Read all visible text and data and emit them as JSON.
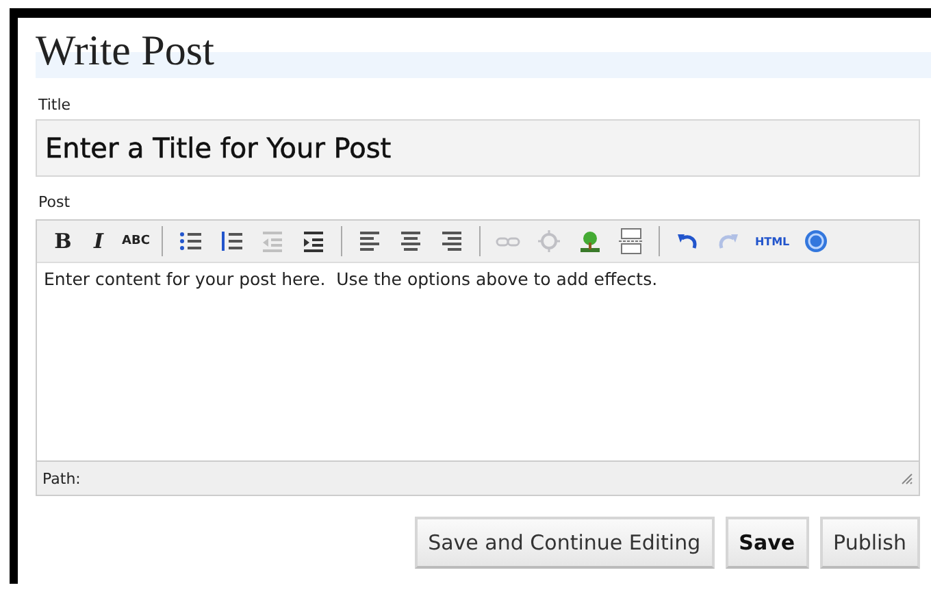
{
  "heading": "Write Post",
  "title_field": {
    "label": "Title",
    "value": "Enter a Title for Your Post"
  },
  "post_editor": {
    "label": "Post",
    "toolbar": [
      {
        "kind": "bold",
        "label": "B",
        "disabled": false
      },
      {
        "kind": "italic",
        "label": "I",
        "disabled": false
      },
      {
        "kind": "strike",
        "label": "ABC",
        "disabled": false
      },
      {
        "kind": "separator"
      },
      {
        "kind": "bullets",
        "disabled": false
      },
      {
        "kind": "numbers",
        "disabled": false
      },
      {
        "kind": "outdent",
        "disabled": true
      },
      {
        "kind": "indent",
        "disabled": false
      },
      {
        "kind": "separator"
      },
      {
        "kind": "align-left",
        "disabled": false
      },
      {
        "kind": "align-center",
        "disabled": false
      },
      {
        "kind": "align-right",
        "disabled": false
      },
      {
        "kind": "separator"
      },
      {
        "kind": "link",
        "disabled": true
      },
      {
        "kind": "unlink",
        "disabled": true
      },
      {
        "kind": "image",
        "disabled": false
      },
      {
        "kind": "pagebreak",
        "disabled": false
      },
      {
        "kind": "separator"
      },
      {
        "kind": "undo",
        "disabled": false
      },
      {
        "kind": "redo",
        "disabled": true
      },
      {
        "kind": "html",
        "label": "HTML",
        "disabled": false
      },
      {
        "kind": "help",
        "disabled": false
      }
    ],
    "value": "Enter content for your post here.  Use the options above to add effects.",
    "path_label": "Path:"
  },
  "buttons": [
    {
      "label": "Save and Continue Editing",
      "bold": false
    },
    {
      "label": "Save",
      "bold": true
    },
    {
      "label": "Publish",
      "bold": false
    }
  ]
}
